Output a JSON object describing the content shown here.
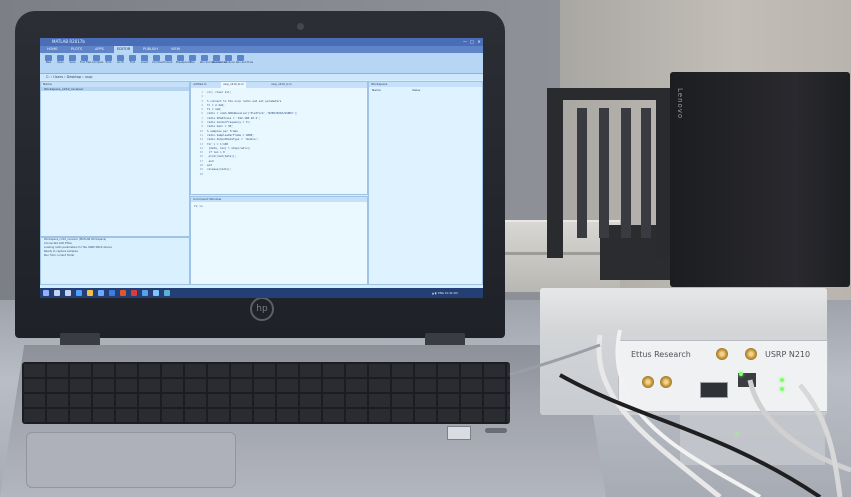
{
  "matlab": {
    "window_title": "MATLAB R2017b",
    "window_controls": [
      "—",
      "□",
      "✕"
    ],
    "ribbon_tabs": [
      "HOME",
      "PLOTS",
      "APPS",
      "EDITOR",
      "PUBLISH",
      "VIEW"
    ],
    "active_tab": "EDITOR",
    "search_placeholder": "Search Documentation",
    "ribbon_buttons": [
      "New",
      "Open",
      "Save",
      "Find Files",
      "Compare",
      "Print",
      "Go To",
      "Find",
      "Insert",
      "Comment",
      "Indent",
      "Breakpoints",
      "Run",
      "Run and Advance",
      "Run Section",
      "Advance",
      "Run and Time"
    ],
    "address_bar": "C: › Users › Desktop › usrp",
    "current_folder_label": "Name",
    "folder_item": "Workspace_n210_receiver",
    "editor_tabs": [
      "untitled.m",
      "usrp_n210_tx.m",
      "usrp_n210_rx.m"
    ],
    "code_lines": [
      {
        "n": "1",
        "text": "clc; clear all;"
      },
      {
        "n": "2",
        "text": ""
      },
      {
        "n": "3",
        "text": "% connect to the usrp radio and set parameters"
      },
      {
        "n": "4",
        "text": "fc = 2.4e9;"
      },
      {
        "n": "5",
        "text": "fs = 1e6;"
      },
      {
        "n": "6",
        "text": "radio = comm.SDRuReceiver('Platform','N200/N210/USRP2');"
      },
      {
        "n": "7",
        "text": "radio.IPAddress = '192.168.10.2';"
      },
      {
        "n": "8",
        "text": "radio.CenterFrequency = fc;"
      },
      {
        "n": "9",
        "text": "radio.Gain = 30;"
      },
      {
        "n": "10",
        "text": "% samples per frame"
      },
      {
        "n": "11",
        "text": "radio.SamplesPerFrame = 4000;"
      },
      {
        "n": "12",
        "text": "radio.OutputDataType = 'double';"
      },
      {
        "n": "13",
        "text": "for i = 1:100"
      },
      {
        "n": "14",
        "text": "  [data, len] = step(radio);"
      },
      {
        "n": "15",
        "text": "  if len > 0"
      },
      {
        "n": "16",
        "text": "    plot(real(data));"
      },
      {
        "n": "17",
        "text": "  end"
      },
      {
        "n": "18",
        "text": "end"
      },
      {
        "n": "19",
        "text": "release(radio);"
      },
      {
        "n": "20",
        "text": ""
      }
    ],
    "command_window_label": "Command Window",
    "command_prompt": "fx >>",
    "details_lines": [
      "Workspace_n210_receiver (MATLAB Workspace)",
      "Connected with Ettus",
      "Loading radio parameters for the USRP N210 device",
      "Ready to capture samples",
      "Run from current folder"
    ],
    "workspace_label": "Workspace",
    "workspace_columns": [
      "Name",
      "Value"
    ],
    "taskbar_tray": "▲ ◐ ENG 10:42 AM"
  },
  "hardware": {
    "laptop_brand": "hp",
    "pc_brand": "Lenovo",
    "device_brand": "Ettus Research",
    "device_model": "USRP N210"
  },
  "colors": {
    "screen_bg": "#d3efff",
    "titlebar": "#4a6db8",
    "taskbar": "#233f74",
    "led": "#7cff6a"
  }
}
